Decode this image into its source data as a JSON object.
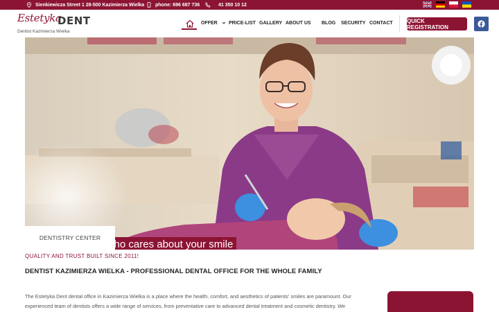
{
  "topbar": {
    "address": "Sienkiewicza Street 1 28-500 Kazimierza Wielka",
    "phone": "phone: 696 687 736",
    "phone2": "41 350 10 12",
    "flags": [
      "english-flag-icon",
      "german-flag-icon",
      "polish-flag-icon",
      "ukrainian-flag-icon"
    ]
  },
  "logo": {
    "script": "Estetyka",
    "brand": "DENT",
    "subtitle": "Dentist Kazimierza Wielka"
  },
  "nav": {
    "items": [
      {
        "label": "OFFER"
      },
      {
        "label": "PRICE-LIST"
      },
      {
        "label": "GALLERY"
      },
      {
        "label": "ABOUT US"
      },
      {
        "label": "BLOG"
      },
      {
        "label": "SECURITY"
      },
      {
        "label": "CONTACT"
      }
    ],
    "cta": "QUICK REGISTRATION"
  },
  "hero": {
    "caption": "A dentist who cares about your smile",
    "tag": "DENTISTRY CENTER"
  },
  "content": {
    "subhead": "QUALITY AND TRUST BUILT SINCE 2011!",
    "title": "DENTIST KAZIMIERZA WIELKA - PROFESSIONAL DENTAL OFFICE FOR THE WHOLE FAMILY",
    "paragraph_line1": "The Estetyka Dent dental office in Kazimierza Wielka is a place where the health, comfort, and aesthetics of patients' smiles are paramount. Our",
    "paragraph_line2": "experienced team of dentists offers a wide range of services, from preventative care to advanced dental treatment and cosmetic dentistry. We"
  },
  "colors": {
    "brand": "#8c1433",
    "facebook": "#3b5998"
  }
}
